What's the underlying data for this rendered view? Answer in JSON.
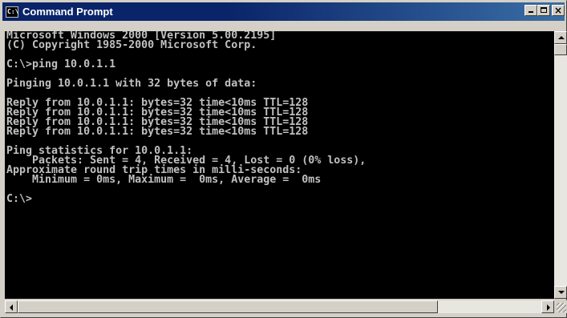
{
  "window": {
    "title": "Command Prompt",
    "icon_text": "C:\\"
  },
  "console": {
    "lines": [
      "Microsoft Windows 2000 [Version 5.00.2195]",
      "(C) Copyright 1985-2000 Microsoft Corp.",
      "",
      "C:\\>ping 10.0.1.1",
      "",
      "Pinging 10.0.1.1 with 32 bytes of data:",
      "",
      "Reply from 10.0.1.1: bytes=32 time<10ms TTL=128",
      "Reply from 10.0.1.1: bytes=32 time<10ms TTL=128",
      "Reply from 10.0.1.1: bytes=32 time<10ms TTL=128",
      "Reply from 10.0.1.1: bytes=32 time<10ms TTL=128",
      "",
      "Ping statistics for 10.0.1.1:",
      "    Packets: Sent = 4, Received = 4, Lost = 0 (0% loss),",
      "Approximate round trip times in milli-seconds:",
      "    Minimum = 0ms, Maximum =  0ms, Average =  0ms",
      "",
      "C:\\>"
    ],
    "text_color": "#c0c0c0",
    "background": "#000000"
  },
  "icons": {
    "app": "cmd-icon",
    "minimize": "minimize-icon",
    "maximize": "maximize-icon",
    "close": "close-icon"
  },
  "close_glyph": "×"
}
